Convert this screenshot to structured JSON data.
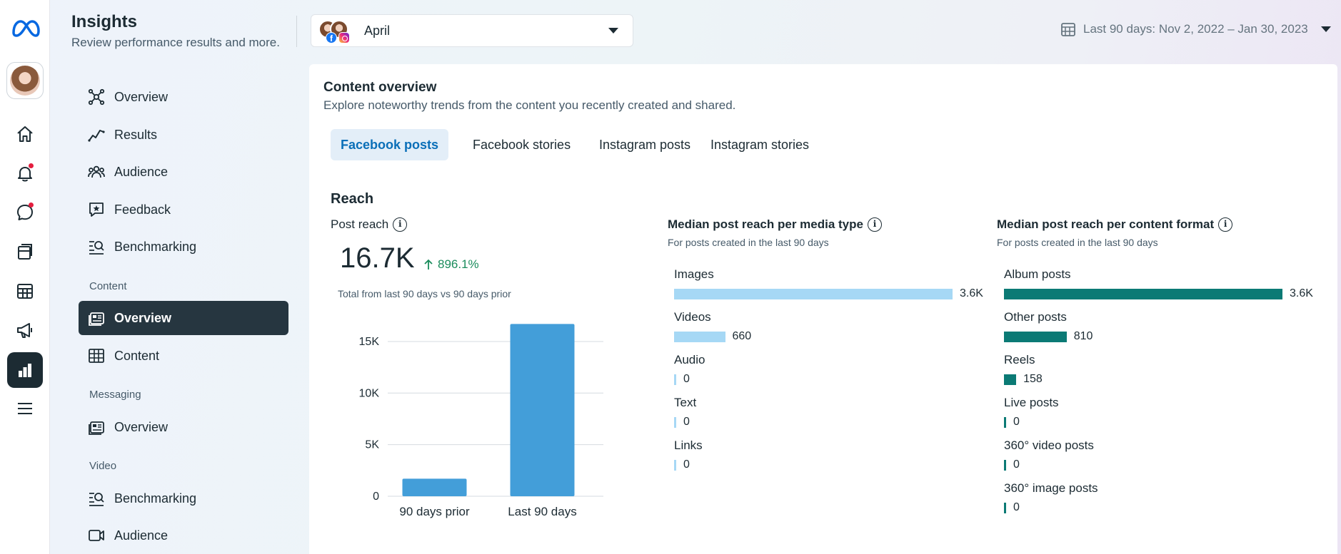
{
  "app": {
    "title": "Insights",
    "subtitle": "Review performance results and more."
  },
  "sidebar": {
    "sections": {
      "content": "Content",
      "messaging": "Messaging",
      "video": "Video"
    },
    "items": [
      {
        "label": "Overview",
        "icon": "network-icon"
      },
      {
        "label": "Results",
        "icon": "trend-line-icon"
      },
      {
        "label": "Audience",
        "icon": "people-group-icon"
      },
      {
        "label": "Feedback",
        "icon": "speech-star-icon"
      },
      {
        "label": "Benchmarking",
        "icon": "benchmark-search-icon"
      },
      {
        "label": "Overview",
        "icon": "content-overview-icon",
        "active": true
      },
      {
        "label": "Content",
        "icon": "table-icon"
      },
      {
        "label": "Overview",
        "icon": "messaging-overview-icon"
      },
      {
        "label": "Benchmarking",
        "icon": "benchmark-search-icon"
      },
      {
        "label": "Audience",
        "icon": "video-camera-icon"
      }
    ]
  },
  "rail": {
    "icons": [
      "meta-logo-icon",
      "avatar",
      "home-icon",
      "notifications-icon",
      "messages-icon",
      "posts-icon",
      "planner-icon",
      "ads-megaphone-icon",
      "insights-icon",
      "menu-icon"
    ]
  },
  "header": {
    "account_name": "April",
    "date_range": "Last 90 days: Nov 2, 2022 – Jan 30, 2023"
  },
  "content_overview": {
    "title": "Content overview",
    "subtitle": "Explore noteworthy trends from the content you recently created and shared.",
    "tabs": [
      "Facebook posts",
      "Facebook stories",
      "Instagram posts",
      "Instagram stories"
    ],
    "active_tab": "Facebook posts",
    "reach": {
      "title": "Reach",
      "post_reach": {
        "label": "Post reach",
        "value": "16.7K",
        "change": "896.1%",
        "note": "Total from last 90 days vs 90 days prior"
      },
      "media_type": {
        "title": "Median post reach per media type",
        "note": "For posts created in the last 90 days",
        "bar_color": "#a6d8f5",
        "rows": [
          {
            "label": "Images",
            "value": "3.6K",
            "amount": 3600
          },
          {
            "label": "Videos",
            "value": "660",
            "amount": 660
          },
          {
            "label": "Audio",
            "value": "0",
            "amount": 0
          },
          {
            "label": "Text",
            "value": "0",
            "amount": 0
          },
          {
            "label": "Links",
            "value": "0",
            "amount": 0
          }
        ]
      },
      "content_format": {
        "title": "Median post reach per content format",
        "note": "For posts created in the last 90 days",
        "bar_color": "#0b7a75",
        "rows": [
          {
            "label": "Album posts",
            "value": "3.6K",
            "amount": 3600
          },
          {
            "label": "Other posts",
            "value": "810",
            "amount": 810
          },
          {
            "label": "Reels",
            "value": "158",
            "amount": 158
          },
          {
            "label": "Live posts",
            "value": "0",
            "amount": 0
          },
          {
            "label": "360° video posts",
            "value": "0",
            "amount": 0
          },
          {
            "label": "360° image posts",
            "value": "0",
            "amount": 0
          }
        ]
      }
    }
  },
  "chart_data": {
    "type": "bar",
    "categories": [
      "90 days prior",
      "Last 90 days"
    ],
    "values": [
      1700,
      16700
    ],
    "ylim": [
      0,
      17000
    ],
    "yticks": [
      0,
      5000,
      10000,
      15000
    ],
    "ytick_labels": [
      "0",
      "5K",
      "10K",
      "15K"
    ],
    "grid": true,
    "bar_color": "#439ed9"
  }
}
